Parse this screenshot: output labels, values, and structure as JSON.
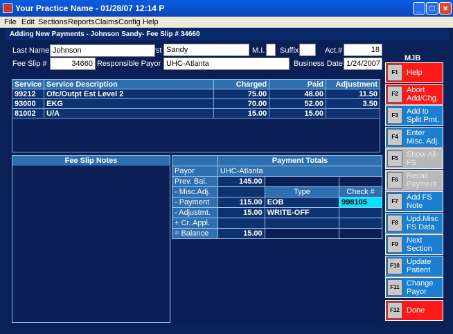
{
  "window": {
    "title": "Your Practice Name  -  01/28/07 12:14 P",
    "controls": [
      "minimize",
      "maximize",
      "close"
    ]
  },
  "menu": [
    "File",
    "Edit",
    "Sections",
    "Reports",
    "Claims",
    "Config",
    "Help"
  ],
  "subtitle": "Adding New Payments - Johnson Sandy- Fee Slip # 34660",
  "form": {
    "last_name_label": "Last Name",
    "last_name": "Johnson",
    "first_label": "First",
    "first": "Sandy",
    "mi_label": "M.I.",
    "mi": "",
    "suffix_label": "Suffix",
    "suffix": "",
    "act_label": "Act.#",
    "act": "18",
    "fee_slip_label": "Fee Slip #",
    "fee_slip": "34660",
    "resp_payor_label": "Responsible Payor",
    "resp_payor": "UHC-Atlanta",
    "business_date_label": "Business Date",
    "business_date": "1/24/2007"
  },
  "services": {
    "headers": [
      "Service",
      "Service Description",
      "Charged",
      "Paid",
      "Adjustment"
    ],
    "rows": [
      [
        "99212",
        "Ofc/Outpt Est Level 2",
        "75.00",
        "48.00",
        "11.50"
      ],
      [
        "93000",
        "EKG",
        "70.00",
        "52.00",
        "3.50"
      ],
      [
        "81002",
        "U/A",
        "15.00",
        "15.00",
        ""
      ]
    ]
  },
  "notes": {
    "title": "Fee Slip Notes"
  },
  "payment_totals": {
    "title": "Payment Totals",
    "payor_label": "Payor",
    "payor": "UHC-Atlanta",
    "prev_bal_label": "Prev. Bal.",
    "prev_bal": "145.00",
    "misc_adj_label": "- Misc.Adj.",
    "type_header": "Type",
    "check_header": "Check #",
    "payment_label": "- Payment",
    "payment": "115.00",
    "payment_type": "EOB",
    "payment_check": "998105",
    "adjust_label": "- Adjustmt.",
    "adjust": "15.00",
    "adjust_type": "WRITE-OFF",
    "cr_appl_label": "+ Cr. Appl.",
    "balance_label": "= Balance",
    "balance": "15.00"
  },
  "sidebar": {
    "user": "MJB",
    "keys": [
      {
        "key": "F1",
        "label": "Help",
        "color": "red"
      },
      {
        "key": "F2",
        "label": "Abort Add/Chg.",
        "color": "red"
      },
      {
        "key": "F3",
        "label": "Add to Split Pmt.",
        "color": "blue"
      },
      {
        "key": "F4",
        "label": "Enter Misc. Adj.",
        "color": "blue"
      },
      {
        "key": "F5",
        "label": "Show All FS",
        "color": "grey"
      },
      {
        "key": "F6",
        "label": "Recall Payment",
        "color": "grey"
      },
      {
        "key": "F7",
        "label": "Add FS Note",
        "color": "blue"
      },
      {
        "key": "F8",
        "label": "Upd.Misc FS Data",
        "color": "blue"
      },
      {
        "key": "F9",
        "label": "Next Section",
        "color": "blue"
      },
      {
        "key": "F10",
        "label": "Update Patient",
        "color": "blue"
      },
      {
        "key": "F11",
        "label": "Change Payor",
        "color": "blue"
      },
      {
        "key": "F12",
        "label": "Done",
        "color": "red"
      }
    ]
  }
}
